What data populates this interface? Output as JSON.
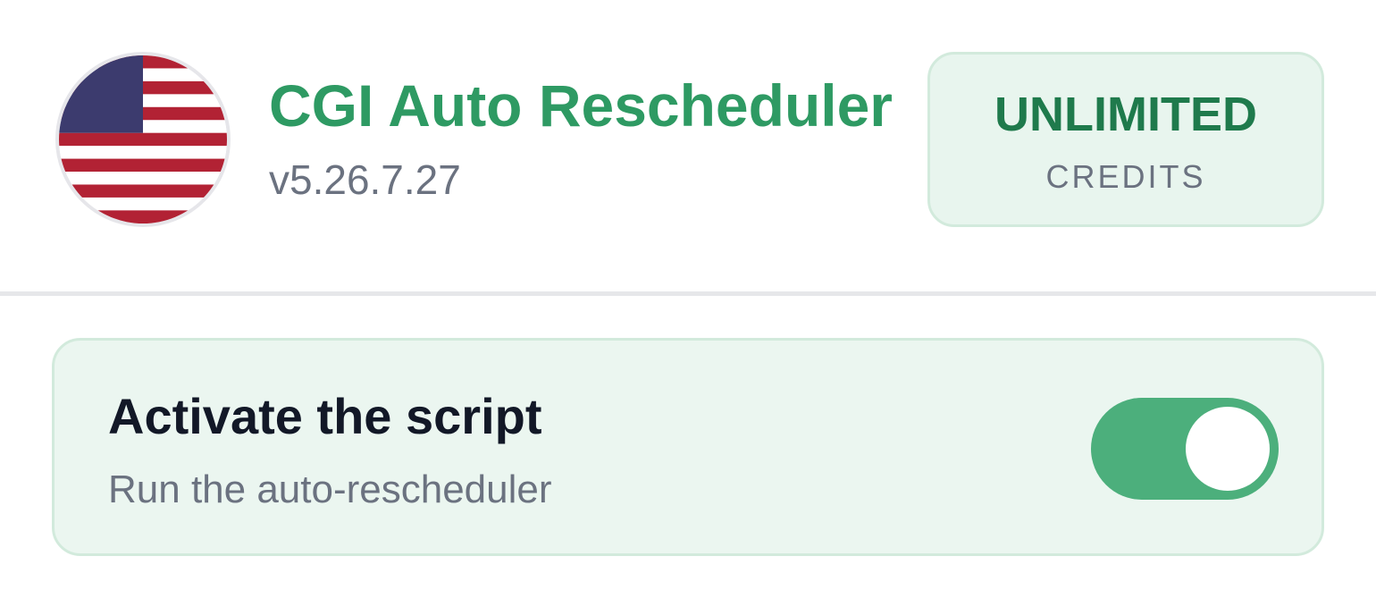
{
  "header": {
    "title": "CGI Auto Rescheduler",
    "version": "v5.26.7.27",
    "flag_icon": "us-flag-icon",
    "credits": {
      "value": "UNLIMITED",
      "label": "CREDITS"
    }
  },
  "activation": {
    "title": "Activate the script",
    "subtitle": "Run the auto-rescheduler",
    "toggle_on": true
  },
  "colors": {
    "accent": "#2e9a63",
    "toggle": "#4caf7c",
    "card_bg": "#ebf6f0",
    "flag_red": "#b22234",
    "flag_blue": "#3c3b6e"
  }
}
